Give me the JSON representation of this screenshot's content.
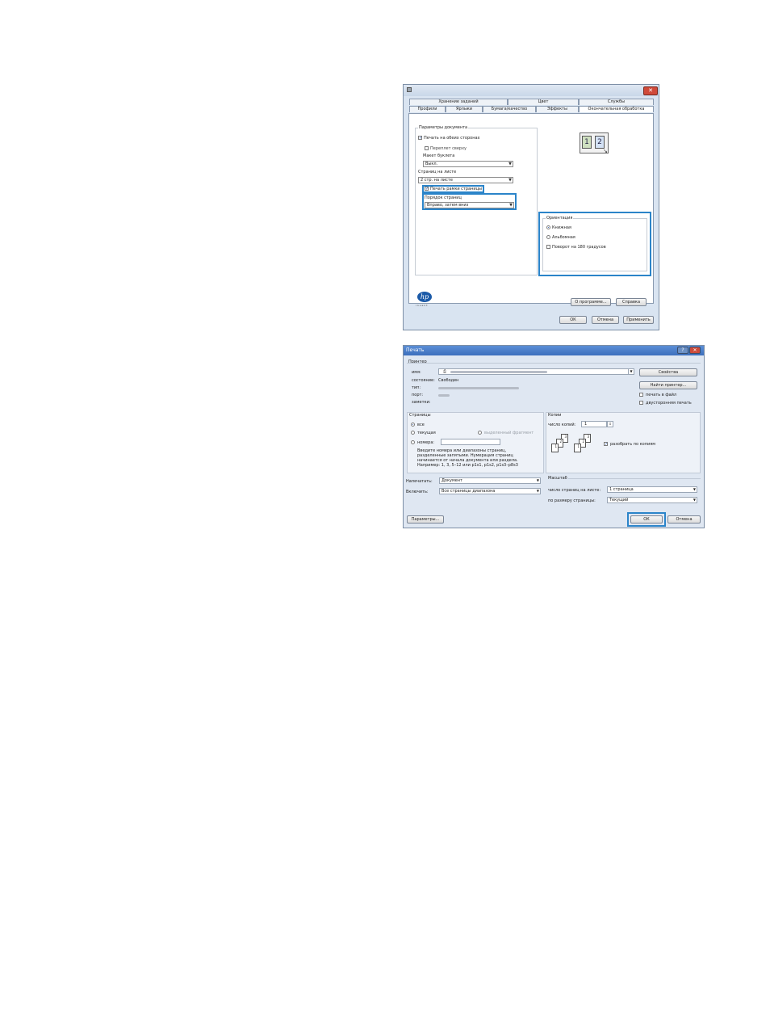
{
  "dialog1": {
    "tabs_top": [
      "Хранение заданий",
      "Цвет",
      "Службы"
    ],
    "tabs_bottom": [
      "Профили",
      "Ярлыки",
      "Бумага/качество",
      "Эффекты",
      "Окончательная обработка"
    ],
    "doc_params_legend": "Параметры документа",
    "duplex_label": "Печать на обеих сторонах",
    "flip_up_label": "Переплет сверху",
    "booklet_layout_label": "Макет буклета",
    "booklet_value": "Выкл.",
    "pages_per_sheet_label": "Страниц на листе",
    "pages_per_sheet_value": "2 стр. на листе",
    "print_borders_label": "Печать рамки страницы",
    "page_order_label": "Порядок страниц",
    "page_order_value": "Вправо, затем вниз",
    "preview_nums": [
      "1",
      "2"
    ],
    "orientation_legend": "Ориентация",
    "portrait_label": "Книжная",
    "landscape_label": "Альбомная",
    "rotate_label": "Поворот на 180 градусов",
    "brand_text": "invent",
    "about_button": "О программе...",
    "help_button": "Справка",
    "ok_button": "ОК",
    "cancel_button": "Отмена",
    "apply_button": "Применить"
  },
  "dialog2": {
    "title": "Печать",
    "help_glyph": "?",
    "close_glyph": "✕",
    "printer_legend": "Принтер",
    "name_label": "имя:",
    "status_label": "состояние:",
    "status_value": "Свободен",
    "type_label": "тип:",
    "port_label": "порт:",
    "notes_label": "заметки:",
    "properties_button": "Свойства",
    "find_printer_button": "Найти принтер...",
    "print_to_file_label": "печать в файл",
    "manual_duplex_label": "двусторонняя печать",
    "pages_legend": "Страницы",
    "all_label": "все",
    "current_label": "текущая",
    "selection_label": "выделенный фрагмент",
    "numbers_label": "номера:",
    "help_lines": [
      "Введите номера или диапазоны страниц,",
      "разделенные запятыми. Нумерация страниц",
      "начинается от начала документа или раздела.",
      "Например: 1, 3, 5–12 или p1s1, p1s2, p1s3–p8s3"
    ],
    "copies_legend": "Копии",
    "copies_label": "число копий:",
    "copies_value": "1",
    "collate_label": "разобрать по копиям",
    "collate_pages": [
      "3",
      "2",
      "1",
      "3",
      "2",
      "1"
    ],
    "print_what_label": "Напечатать:",
    "print_what_value": "Документ",
    "include_label": "Включить:",
    "include_value": "Все страницы диапазона",
    "zoom_legend": "Масштаб",
    "pages_per_sheet_label": "число страниц на листе:",
    "pages_per_sheet_value": "1 страница",
    "scale_label": "по размеру страницы:",
    "scale_value": "Текущий",
    "options_button": "Параметры...",
    "ok_button": "ОК",
    "cancel_button": "Отмена"
  },
  "colors": {
    "highlight": "#2b84c9",
    "titlebar": "#3c6fbd"
  }
}
